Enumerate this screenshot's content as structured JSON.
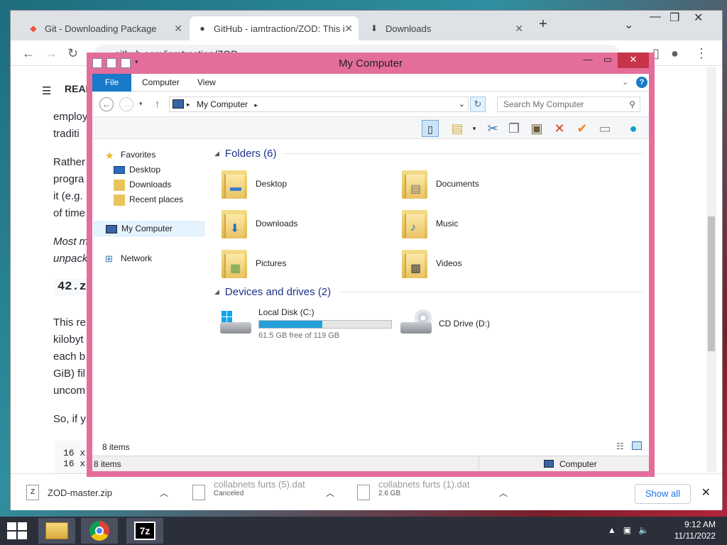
{
  "chrome": {
    "tabs": [
      {
        "label": "Git - Downloading Package",
        "icon": "git-icon"
      },
      {
        "label": "GitHub - iamtraction/ZOD: This i",
        "icon": "github-icon"
      },
      {
        "label": "Downloads",
        "icon": "download-icon"
      }
    ],
    "new_tab": "+",
    "url": "github.com/iamtraction/ZOD",
    "page": {
      "header": "READ",
      "lines": [
        "employ",
        "traditi",
        "Rather",
        "progra",
        "it (e.g.",
        "of time",
        "Most m",
        "unpack",
        "42.z",
        "This re",
        "kilobyt",
        "each b",
        "GiB) fil",
        "uncom",
        "So, if y"
      ],
      "code": [
        "16 x",
        "16 x"
      ]
    },
    "downloads": [
      {
        "name": "ZOD-master.zip",
        "sub": ""
      },
      {
        "name": "collabnets furts (5).dat",
        "sub": "Canceled"
      },
      {
        "name": "collabnets furts (1).dat",
        "sub": "2.6 GB"
      }
    ],
    "show_all": "Show all"
  },
  "explorer": {
    "title": "My Computer",
    "ribbon_tabs": [
      "File",
      "Computer",
      "View"
    ],
    "address": "My Computer",
    "search_placeholder": "Search My Computer",
    "nav": {
      "favorites": "Favorites",
      "fav_items": [
        "Desktop",
        "Downloads",
        "Recent places"
      ],
      "computer": "My Computer",
      "network": "Network"
    },
    "folders_header": "Folders (6)",
    "folders": [
      "Desktop",
      "Documents",
      "Downloads",
      "Music",
      "Pictures",
      "Videos"
    ],
    "drives_header": "Devices and drives (2)",
    "drives": [
      {
        "name": "Local Disk (C:)",
        "free": "61.5 GB free of 119 GB",
        "used_fraction": 0.48
      },
      {
        "name": "CD Drive (D:)"
      }
    ],
    "status_items": "8 items",
    "status_bottom": "8 items",
    "status_location": "Computer"
  },
  "taskbar": {
    "time": "9:12 AM",
    "date": "11/11/2022"
  },
  "colors": {
    "explorer_frame": "#e56d9b",
    "file_tab": "#1979ca",
    "drive_fill": "#26a0da"
  }
}
